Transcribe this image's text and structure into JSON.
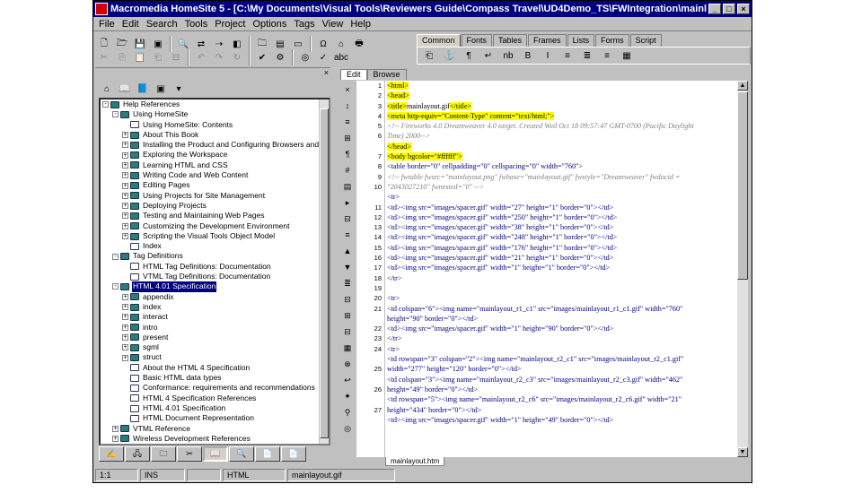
{
  "window": {
    "title": "Macromedia HomeSite 5 - [C:\\My Documents\\Visual Tools\\Reviewers Guide\\Compass Travel\\UD4Demo_TS\\FWIntegration\\mainlayout.htm]",
    "minimize": "_",
    "maximize": "□",
    "close": "×"
  },
  "menu": [
    "File",
    "Edit",
    "Search",
    "Tools",
    "Project",
    "Options",
    "Tags",
    "View",
    "Help"
  ],
  "toolbar1": [
    "new-icon",
    "open-icon",
    "save-icon",
    "save-all-icon",
    "find-icon",
    "replace-icon",
    "find-next-icon",
    "browse-icon",
    "open-file-icon",
    "preview-icon",
    "tag-chooser-icon",
    "omega-icon",
    "spell-icon",
    "print-icon"
  ],
  "toolbar2": [
    "cut-icon",
    "copy-icon",
    "paste-icon",
    "paste-special-icon",
    "copy-html-icon",
    "undo-icon",
    "redo-icon",
    "refresh-icon",
    "tag-insight-icon",
    "validate-icon",
    "web-icon",
    "spell-check-icon",
    "abc-icon"
  ],
  "quickbar": {
    "tabs": [
      "Common",
      "Fonts",
      "Tables",
      "Frames",
      "Lists",
      "Forms",
      "Script"
    ],
    "active_tab": "Common"
  },
  "resource": {
    "items": [
      {
        "level": 0,
        "exp": "-",
        "icon": "book",
        "text": "Help References"
      },
      {
        "level": 1,
        "exp": "-",
        "icon": "book",
        "text": "Using HomeSite"
      },
      {
        "level": 2,
        "exp": "",
        "icon": "page",
        "text": "Using HomeSite: Contents"
      },
      {
        "level": 2,
        "exp": "+",
        "icon": "book",
        "text": "About This Book"
      },
      {
        "level": 2,
        "exp": "+",
        "icon": "book",
        "text": "Installing the Product and Configuring Browsers and Servers"
      },
      {
        "level": 2,
        "exp": "+",
        "icon": "book",
        "text": "Exploring the Workspace"
      },
      {
        "level": 2,
        "exp": "+",
        "icon": "book",
        "text": "Learning HTML and CSS"
      },
      {
        "level": 2,
        "exp": "+",
        "icon": "book",
        "text": "Writing Code and Web Content"
      },
      {
        "level": 2,
        "exp": "+",
        "icon": "book",
        "text": "Editing Pages"
      },
      {
        "level": 2,
        "exp": "+",
        "icon": "book",
        "text": "Using Projects for Site Management"
      },
      {
        "level": 2,
        "exp": "+",
        "icon": "book",
        "text": "Deploying Projects"
      },
      {
        "level": 2,
        "exp": "+",
        "icon": "book",
        "text": "Testing and Maintaining  Web Pages"
      },
      {
        "level": 2,
        "exp": "+",
        "icon": "book",
        "text": "Customizing the Development Environment"
      },
      {
        "level": 2,
        "exp": "+",
        "icon": "book",
        "text": "Scripting the Visual Tools Object Model"
      },
      {
        "level": 2,
        "exp": "",
        "icon": "page",
        "text": "Index"
      },
      {
        "level": 1,
        "exp": "-",
        "icon": "book",
        "text": "Tag Definitions"
      },
      {
        "level": 2,
        "exp": "",
        "icon": "page",
        "text": "HTML Tag Definitions: Documentation"
      },
      {
        "level": 2,
        "exp": "",
        "icon": "page",
        "text": "VTML Tag Definitions: Documentation"
      },
      {
        "level": 1,
        "exp": "-",
        "icon": "book",
        "text": "HTML 4.01 Specification",
        "selected": true
      },
      {
        "level": 2,
        "exp": "+",
        "icon": "book",
        "text": "appendix"
      },
      {
        "level": 2,
        "exp": "+",
        "icon": "book",
        "text": "index"
      },
      {
        "level": 2,
        "exp": "+",
        "icon": "book",
        "text": "interact"
      },
      {
        "level": 2,
        "exp": "+",
        "icon": "book",
        "text": "intro"
      },
      {
        "level": 2,
        "exp": "+",
        "icon": "book",
        "text": "present"
      },
      {
        "level": 2,
        "exp": "+",
        "icon": "book",
        "text": "sgml"
      },
      {
        "level": 2,
        "exp": "+",
        "icon": "book",
        "text": "struct"
      },
      {
        "level": 2,
        "exp": "",
        "icon": "page",
        "text": "About the HTML 4 Specification"
      },
      {
        "level": 2,
        "exp": "",
        "icon": "page",
        "text": "Basic HTML data types"
      },
      {
        "level": 2,
        "exp": "",
        "icon": "page",
        "text": "Conformance: requirements and recommendations"
      },
      {
        "level": 2,
        "exp": "",
        "icon": "page",
        "text": "HTML 4 Specification References"
      },
      {
        "level": 2,
        "exp": "",
        "icon": "page",
        "text": "HTML 4.01 Specification"
      },
      {
        "level": 2,
        "exp": "",
        "icon": "page",
        "text": "HTML Document Representation"
      },
      {
        "level": 1,
        "exp": "+",
        "icon": "book",
        "text": "VTML Reference"
      },
      {
        "level": 1,
        "exp": "+",
        "icon": "book",
        "text": "Wireless Development References"
      }
    ],
    "tabs": [
      "files-tab",
      "projects-tab",
      "site-view-tab",
      "snippets-tab",
      "help-tab",
      "tag-inspector-tab",
      "pages-tab",
      "resources-tab"
    ],
    "tab_icons": [
      "✍",
      "🖧",
      "🗀",
      "✂",
      "📖",
      "🔍",
      "📄",
      "📄"
    ],
    "active_tab": 4
  },
  "editor": {
    "tabs": [
      "Edit",
      "Browse"
    ],
    "active_tab": "Edit",
    "tools": [
      "×",
      "↕",
      "≡",
      "⊞",
      "¶",
      "#",
      "▤",
      "▸",
      "⊟",
      "≡",
      "▲",
      "▼",
      "≣",
      "⊟",
      "⊞",
      "⊟",
      "▦",
      "⊗",
      "↩",
      "✦",
      "⚲",
      "◎"
    ],
    "doc_tab": "mainlayout.htm",
    "gutter": [
      "1",
      "2",
      "3",
      "4",
      "5",
      "6",
      "",
      "7",
      "8",
      "9",
      "10",
      "",
      "11",
      "12",
      "13",
      "14",
      "15",
      "16",
      "17",
      "18",
      "19",
      "20",
      "21",
      "",
      "22",
      "23",
      "24",
      "",
      "25",
      "",
      "26",
      "",
      "27",
      ""
    ],
    "lines": [
      [
        {
          "t": "<html>",
          "c": "hl"
        }
      ],
      [
        {
          "t": "<head>",
          "c": "hl"
        }
      ],
      [
        {
          "t": "<title>",
          "c": "hl"
        },
        {
          "t": "mainlayout.gif",
          "c": ""
        },
        {
          "t": "</title>",
          "c": "hl"
        }
      ],
      [
        {
          "t": "<meta http-equiv=\"Content-Type\" content=\"text/html;\">",
          "c": "hl"
        }
      ],
      [
        {
          "t": "<!-- Fireworks 4.0  Dreamweaver 4.0 target.  Created Wed Oct 18 09:57:47 GMT-0700 (Pacific Daylight",
          "c": "cm"
        }
      ],
      [
        {
          "t": "Time) 2000-->",
          "c": "cm"
        }
      ],
      [
        {
          "t": "</head>",
          "c": "hl"
        }
      ],
      [
        {
          "t": "<body bgcolor=\"#ffffff\">",
          "c": "hl"
        }
      ],
      [
        {
          "t": "<table border=\"0\" cellpadding=\"0\" cellspacing=\"0\" width=\"760\">",
          "c": "tag"
        }
      ],
      [
        {
          "t": "<!-- fwtable fwsrc=\"mainlayout.png\" fwbase=\"mainlayout.gif\" fwstyle=\"Dreamweaver\" fwdocid =",
          "c": "cm"
        }
      ],
      [
        {
          "t": "\"2043027210\" fwnested=\"0\" -->",
          "c": "cm"
        }
      ],
      [
        {
          "t": "  <tr>",
          "c": "tag"
        }
      ],
      [
        {
          "t": "    <td><img src=\"images/spacer.gif\" width=\"27\" height=\"1\" border=\"0\"></td>",
          "c": "tag"
        }
      ],
      [
        {
          "t": "    <td><img src=\"images/spacer.gif\" width=\"250\" height=\"1\" border=\"0\"></td>",
          "c": "tag"
        }
      ],
      [
        {
          "t": "    <td><img src=\"images/spacer.gif\" width=\"38\" height=\"1\" border=\"0\"></td>",
          "c": "tag"
        }
      ],
      [
        {
          "t": "    <td><img src=\"images/spacer.gif\" width=\"248\" height=\"1\" border=\"0\"></td>",
          "c": "tag"
        }
      ],
      [
        {
          "t": "    <td><img src=\"images/spacer.gif\" width=\"176\" height=\"1\" border=\"0\"></td>",
          "c": "tag"
        }
      ],
      [
        {
          "t": "    <td><img src=\"images/spacer.gif\" width=\"21\" height=\"1\" border=\"0\"></td>",
          "c": "tag"
        }
      ],
      [
        {
          "t": "    <td><img src=\"images/spacer.gif\" width=\"1\" height=\"1\" border=\"0\"></td>",
          "c": "tag"
        }
      ],
      [
        {
          "t": "  </tr>",
          "c": "tag"
        }
      ],
      [
        {
          "t": "",
          "c": ""
        }
      ],
      [
        {
          "t": "  <tr>",
          "c": "tag"
        }
      ],
      [
        {
          "t": "    <td colspan=\"6\"><img name=\"mainlayout_r1_c1\" src=\"images/mainlayout_r1_c1.gif\" width=\"760\"",
          "c": "tag"
        }
      ],
      [
        {
          "t": "height=\"90\" border=\"0\"></td>",
          "c": "tag"
        }
      ],
      [
        {
          "t": "    <td><img src=\"images/spacer.gif\" width=\"1\" height=\"90\" border=\"0\"></td>",
          "c": "tag"
        }
      ],
      [
        {
          "t": "  </tr>",
          "c": "tag"
        }
      ],
      [
        {
          "t": "  <tr>",
          "c": "tag"
        }
      ],
      [
        {
          "t": "    <td rowspan=\"3\" colspan=\"2\"><img name=\"mainlayout_r2_c1\" src=\"images/mainlayout_r2_c1.gif\"",
          "c": "tag"
        }
      ],
      [
        {
          "t": "width=\"277\" height=\"120\" border=\"0\"></td>",
          "c": "tag"
        }
      ],
      [
        {
          "t": "    <td colspan=\"3\"><img name=\"mainlayout_r2_c3\" src=\"images/mainlayout_r2_c3.gif\" width=\"462\"",
          "c": "tag"
        }
      ],
      [
        {
          "t": "height=\"49\" border=\"0\"></td>",
          "c": "tag"
        }
      ],
      [
        {
          "t": "    <td rowspan=\"5\"><img name=\"mainlayout_r2_c6\" src=\"images/mainlayout_r2_c6.gif\" width=\"21\"",
          "c": "tag"
        }
      ],
      [
        {
          "t": "height=\"434\" border=\"0\"></td>",
          "c": "tag"
        }
      ],
      [
        {
          "t": "    <td><img src=\"images/spacer.gif\" width=\"1\" height=\"49\" border=\"0\"></td>",
          "c": "tag"
        }
      ]
    ]
  },
  "status": {
    "position": "1:1",
    "mode": "INS",
    "empty": "",
    "doctype": "HTML",
    "file": "mainlayout.gif"
  },
  "colors": {
    "titlebar": "#000080",
    "highlight": "#ffff00",
    "tag": "#000080",
    "comment": "#808080"
  }
}
